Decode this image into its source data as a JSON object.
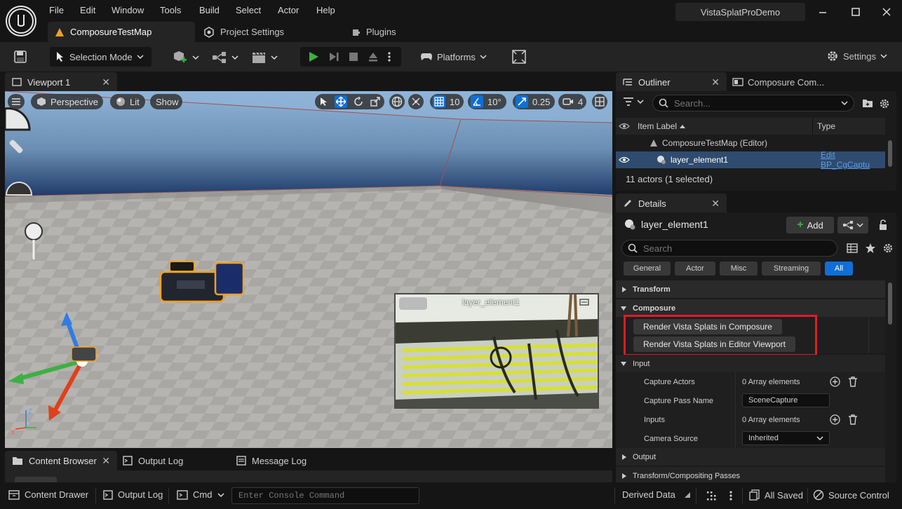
{
  "menu": [
    "File",
    "Edit",
    "Window",
    "Tools",
    "Build",
    "Select",
    "Actor",
    "Help"
  ],
  "project_name": "VistaSplatProDemo",
  "doc_tabs": {
    "map": "ComposureTestMap",
    "project_settings": "Project Settings",
    "plugins": "Plugins"
  },
  "toolbar": {
    "selection_mode": "Selection Mode",
    "platforms": "Platforms",
    "settings": "Settings"
  },
  "viewport": {
    "tab_label": "Viewport 1",
    "perspective": "Perspective",
    "lit": "Lit",
    "show": "Show",
    "grid_snap": "10",
    "rotation_snap": "10°",
    "scale_snap": "0.25",
    "camera_speed": "4",
    "preview_label": "layer_element1"
  },
  "outliner": {
    "tab_label": "Outliner",
    "second_tab_label": "Composure Com...",
    "search_placeholder": "Search...",
    "col_item_label": "Item Label",
    "col_type": "Type",
    "map_row": "ComposureTestMap (Editor)",
    "item_row": "layer_element1",
    "item_type": "Edit BP_CgCaptu",
    "actor_count": "11 actors (1 selected)"
  },
  "details": {
    "tab_label": "Details",
    "object_name": "layer_element1",
    "add_label": "Add",
    "search_placeholder": "Search",
    "categories": [
      "General",
      "Actor",
      "Misc",
      "Streaming",
      "All"
    ],
    "section_transform": "Transform",
    "section_composure": "Composure",
    "btn_render_composure": "Render Vista Splats in Composure",
    "btn_render_viewport": "Render Vista Splats in Editor Viewport",
    "section_input": "Input",
    "prop_capture_actors": "Capture Actors",
    "val_capture_actors": "0 Array elements",
    "prop_capture_pass": "Capture Pass Name",
    "val_capture_pass": "SceneCapture",
    "prop_inputs": "Inputs",
    "val_inputs": "0 Array elements",
    "prop_camera_source": "Camera Source",
    "val_camera_source": "Inherited",
    "section_output": "Output",
    "section_passes": "Transform/Compositing Passes"
  },
  "bottom_tabs": {
    "content_browser": "Content Browser",
    "output_log": "Output Log",
    "message_log": "Message Log"
  },
  "status": {
    "content_drawer": "Content Drawer",
    "output_log": "Output Log",
    "cmd": "Cmd",
    "console_placeholder": "Enter Console Command",
    "derived_data": "Derived Data",
    "all_saved": "All Saved",
    "source_control": "Source Control"
  },
  "colors": {
    "accent_blue": "#0f6fd6",
    "play_green": "#3cb043",
    "highlight_red": "#e01b24",
    "selection_orange": "#f0a020"
  }
}
